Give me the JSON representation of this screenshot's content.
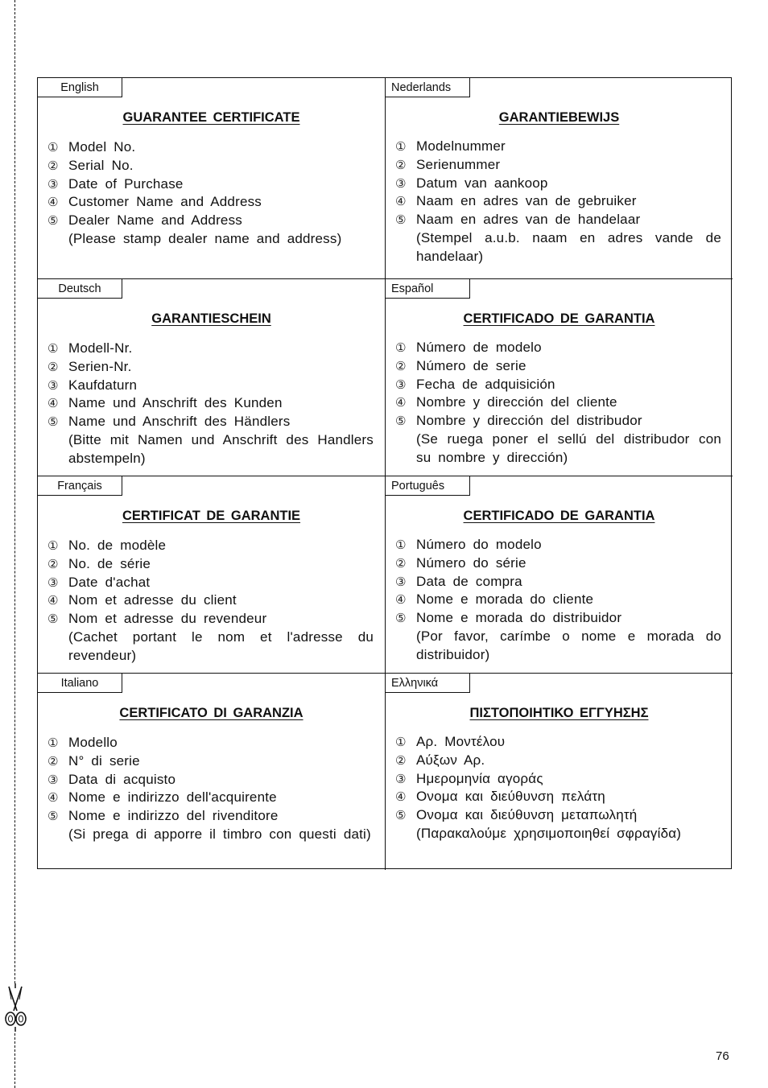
{
  "page_number": "76",
  "cut_line": {
    "icon": "scissors-icon"
  },
  "sections": [
    {
      "language": "English",
      "title": "GUARANTEE  CERTIFICATE",
      "items": [
        {
          "marker": "①",
          "text": "Model  No."
        },
        {
          "marker": "②",
          "text": "Serial  No."
        },
        {
          "marker": "③",
          "text": "Date  of  Purchase"
        },
        {
          "marker": "④",
          "text": "Customer  Name  and  Address"
        },
        {
          "marker": "⑤",
          "text": "Dealer  Name  and  Address"
        }
      ],
      "note": "(Please  stamp  dealer  name  and  address)"
    },
    {
      "language": "Nederlands",
      "title": "GARANTIEBEWIJS",
      "items": [
        {
          "marker": "①",
          "text": "Modelnummer"
        },
        {
          "marker": "②",
          "text": "Serienummer"
        },
        {
          "marker": "③",
          "text": "Datum  van  aankoop"
        },
        {
          "marker": "④",
          "text": "Naam  en  adres  van  de  gebruiker"
        },
        {
          "marker": "⑤",
          "text": "Naam  en  adres  van  de  handelaar"
        }
      ],
      "note": "(Stempel  a.u.b.  naam  en  adres  vande  de  handelaar)"
    },
    {
      "language": "Deutsch",
      "title": "GARANTIESCHEIN",
      "items": [
        {
          "marker": "①",
          "text": "Modell-Nr."
        },
        {
          "marker": "②",
          "text": "Serien-Nr."
        },
        {
          "marker": "③",
          "text": "Kaufdaturn"
        },
        {
          "marker": "④",
          "text": "Name  und  Anschrift  des  Kunden"
        },
        {
          "marker": "⑤",
          "text": "Name  und  Anschrift  des  Händlers"
        }
      ],
      "note": "(Bitte  mit  Namen  und  Anschrift  des  Handlers  abstempeln)"
    },
    {
      "language": "Español",
      "title": "CERTIFICADO  DE  GARANTIA",
      "items": [
        {
          "marker": "①",
          "text": "Número  de  modelo"
        },
        {
          "marker": "②",
          "text": "Número  de  serie"
        },
        {
          "marker": "③",
          "text": "Fecha  de  adquisición"
        },
        {
          "marker": "④",
          "text": "Nombre  y  dirección  del  cliente"
        },
        {
          "marker": "⑤",
          "text": "Nombre  y  dirección  del  distribudor"
        }
      ],
      "note": "(Se  ruega  poner  el  sellú  del  distribudor  con  su  nombre  y  dirección)"
    },
    {
      "language": "Français",
      "title": "CERTIFICAT  DE  GARANTIE",
      "items": [
        {
          "marker": "①",
          "text": "No.  de  modèle"
        },
        {
          "marker": "②",
          "text": "No.  de  série"
        },
        {
          "marker": "③",
          "text": "Date  d'achat"
        },
        {
          "marker": "④",
          "text": "Nom  et  adresse  du  client"
        },
        {
          "marker": "⑤",
          "text": "Nom  et  adresse  du  revendeur"
        }
      ],
      "note": "(Cachet  portant  le  nom  et  l'adresse  du  revendeur)"
    },
    {
      "language": "Português",
      "title": "CERTIFICADO  DE  GARANTIA",
      "items": [
        {
          "marker": "①",
          "text": "Número  do  modelo"
        },
        {
          "marker": "②",
          "text": "Número  do  série"
        },
        {
          "marker": "③",
          "text": "Data  de  compra"
        },
        {
          "marker": "④",
          "text": "Nome  e  morada  do  cliente"
        },
        {
          "marker": "⑤",
          "text": "Nome  e  morada  do  distribuidor"
        }
      ],
      "note": "(Por  favor,  carímbe  o  nome  e  morada  do  distribuidor)"
    },
    {
      "language": "Italiano",
      "title": "CERTIFICATO  DI  GARANZIA",
      "items": [
        {
          "marker": "①",
          "text": "Modello"
        },
        {
          "marker": "②",
          "text": "N°  di  serie"
        },
        {
          "marker": "③",
          "text": "Data  di  acquisto"
        },
        {
          "marker": "④",
          "text": "Nome  e  indirizzo  dell'acquirente"
        },
        {
          "marker": "⑤",
          "text": "Nome  e  indirizzo  del  rivenditore"
        }
      ],
      "note": "(Si  prega  di  apporre  il  timbro  con  questi  dati)"
    },
    {
      "language": "Ελληνικά",
      "title": "ΠΙΣΤΟΠΟΙΗΤΙΚΟ  ΕΓΓΥΗΣΗΣ",
      "items": [
        {
          "marker": "①",
          "text": "Αρ.  Μοντέλου"
        },
        {
          "marker": "②",
          "text": "Αύξων  Αρ."
        },
        {
          "marker": "③",
          "text": "Ημερομηνία  αγοράς"
        },
        {
          "marker": "④",
          "text": "Ονομα  και  διεύθυνση  πελάτη"
        },
        {
          "marker": "⑤",
          "text": "Ονομα  και  διεύθυνση  μεταπωλητή"
        }
      ],
      "note": "(Παρακαλούμε  χρησιμοποιηθεί  σφραγίδα)"
    }
  ]
}
